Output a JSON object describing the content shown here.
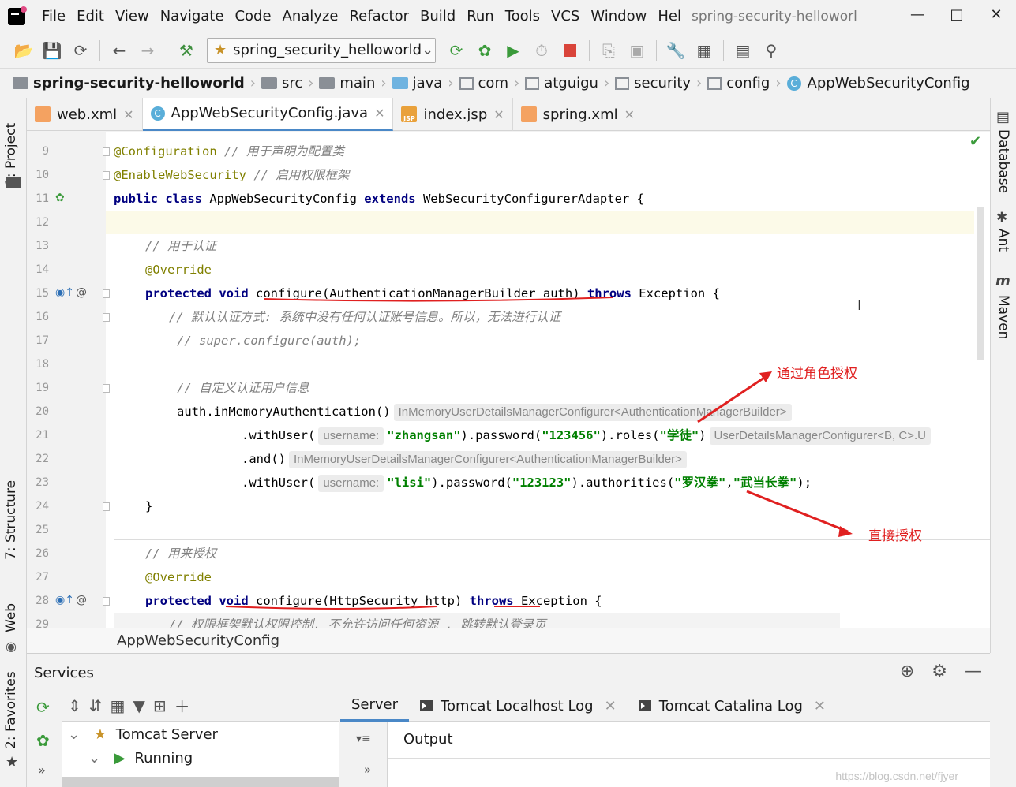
{
  "menubar": {
    "items": [
      "File",
      "Edit",
      "View",
      "Navigate",
      "Code",
      "Analyze",
      "Refactor",
      "Build",
      "Run",
      "Tools",
      "VCS",
      "Window",
      "Hel"
    ],
    "window_title": "spring-security-helloworl"
  },
  "toolbar": {
    "run_config": "spring_security_helloworld"
  },
  "breadcrumb": {
    "project": "spring-security-helloworld",
    "items": [
      "src",
      "main",
      "java",
      "com",
      "atguigu",
      "security",
      "config",
      "AppWebSecurityConfig"
    ]
  },
  "left_stripe": {
    "project": "1: Project",
    "structure": "7: Structure",
    "web": "Web",
    "favorites": "2: Favorites"
  },
  "right_stripe": {
    "database": "Database",
    "ant": "Ant",
    "maven": "Maven"
  },
  "editor_tabs": [
    {
      "label": "web.xml",
      "active": false
    },
    {
      "label": "AppWebSecurityConfig.java",
      "active": true
    },
    {
      "label": "index.jsp",
      "active": false
    },
    {
      "label": "spring.xml",
      "active": false
    }
  ],
  "code": {
    "line_numbers": [
      "9",
      "10",
      "11",
      "12",
      "13",
      "14",
      "15",
      "16",
      "17",
      "18",
      "19",
      "20",
      "21",
      "22",
      "23",
      "24",
      "25",
      "26",
      "27",
      "28",
      "29"
    ],
    "l9_ann": "@Configuration",
    "l9_cmt": "// 用于声明为配置类",
    "l10_ann": "@EnableWebSecurity",
    "l10_cmt": "// 启用权限框架",
    "l11_kw1": "public class",
    "l11_name": " AppWebSecurityConfig ",
    "l11_kw2": "extends",
    "l11_rest": " WebSecurityConfigurerAdapter {",
    "l13_cmt": "// 用于认证",
    "l14_ann": "@Override",
    "l15_kw1": "protected void",
    "l15_sig": " configure(AuthenticationManagerBuilder auth) ",
    "l15_kw2": "throws",
    "l15_rest": " Exception {",
    "l16_cmt": "// 默认认证方式: 系统中没有任何认证账号信息。所以，无法进行认证",
    "l17_cmt": "// super.configure(auth);",
    "l19_cmt": "// 自定义认证用户信息",
    "l20_code": "auth.inMemoryAuthentication()",
    "l20_hint": "InMemoryUserDetailsManagerConfigurer<AuthenticationManagerBuilder>",
    "l21_a": ".withUser(",
    "l21_hint": "username:",
    "l21_user": "\"zhangsan\"",
    "l21_b": ").password(",
    "l21_pw": "\"123456\"",
    "l21_c": ").roles(",
    "l21_role": "\"学徒\"",
    "l21_d": ")",
    "l21_hint2": "UserDetailsManagerConfigurer<B, C>.U",
    "l22_code": ".and()",
    "l22_hint": "InMemoryUserDetailsManagerConfigurer<AuthenticationManagerBuilder>",
    "l23_a": ".withUser(",
    "l23_hint": "username:",
    "l23_user": "\"lisi\"",
    "l23_b": ").password(",
    "l23_pw": "\"123123\"",
    "l23_c": ").authorities(",
    "l23_auth1": "\"罗汉拳\"",
    "l23_comma": ",",
    "l23_auth2": "\"武当长拳\"",
    "l23_d": ");",
    "l24_code": "}",
    "l26_cmt": "// 用来授权",
    "l27_ann": "@Override",
    "l28_kw1": "protected void",
    "l28_sig": " configure(HttpSecurity http) ",
    "l28_kw2": "throws",
    "l28_rest": " Exception {",
    "l29_cmt": "// 权限框架默认权限控制. 不允许访问任何资源 , 跳转默认登录页"
  },
  "annotations": {
    "role_note": "通过角色授权",
    "direct_note": "直接授权"
  },
  "class_crumb": "AppWebSecurityConfig",
  "services": {
    "title": "Services",
    "tree": {
      "server": "Tomcat Server",
      "running": "Running"
    },
    "detail_tabs": [
      {
        "label": "Server",
        "active": true
      },
      {
        "label": "Tomcat Localhost Log",
        "active": false
      },
      {
        "label": "Tomcat Catalina Log",
        "active": false
      }
    ],
    "output_label": "Output"
  },
  "watermark": "https://blog.csdn.net/fjyer",
  "colors": {
    "keyword": "#000080",
    "annotation": "#808000",
    "comment": "#808080",
    "string": "#008000",
    "note_red": "#e02020",
    "accent": "#4a88c7"
  }
}
